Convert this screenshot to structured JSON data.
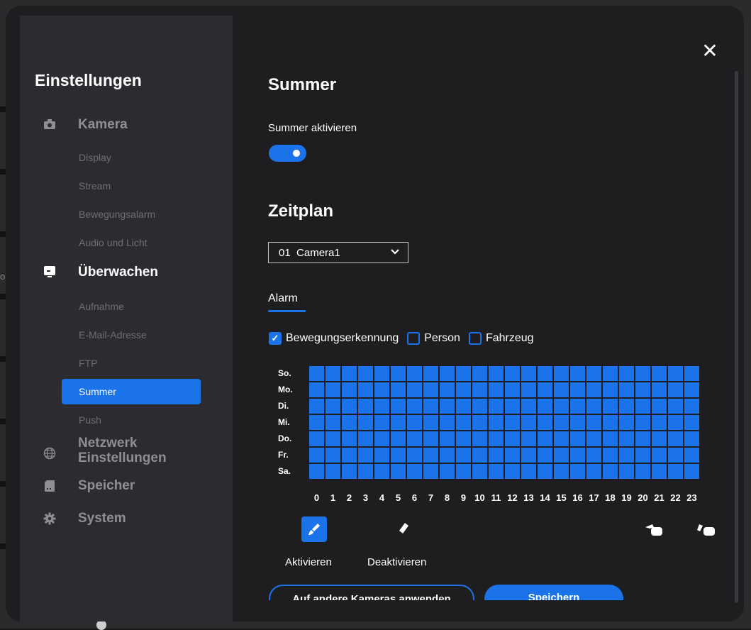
{
  "backdrop": {
    "side_text": "ort"
  },
  "sidebar": {
    "title": "Einstellungen",
    "sections": [
      {
        "label": "Kamera",
        "icon": "camera-icon",
        "items": [
          "Display",
          "Stream",
          "Bewegungsalarm",
          "Audio und Licht"
        ]
      },
      {
        "label": "Überwachen",
        "icon": "monitor-icon",
        "items": [
          "Aufnahme",
          "E-Mail-Adresse",
          "FTP",
          "Summer",
          "Push"
        ],
        "active_item": "Summer"
      },
      {
        "label": "Netzwerk\nEinstellungen",
        "icon": "globe-icon"
      },
      {
        "label": "Speicher",
        "icon": "sd-card-icon"
      },
      {
        "label": "System",
        "icon": "gear-icon"
      }
    ]
  },
  "main": {
    "title": "Summer",
    "toggle_label": "Summer aktivieren",
    "toggle_on": true,
    "schedule_title": "Zeitplan",
    "camera_select": "01  Camera1",
    "tab": "Alarm",
    "checkboxes": [
      {
        "label": "Bewegungserkennung",
        "checked": true
      },
      {
        "label": "Person",
        "checked": false
      },
      {
        "label": "Fahrzeug",
        "checked": false
      }
    ],
    "days": [
      "So.",
      "Mo.",
      "Di.",
      "Mi.",
      "Do.",
      "Fr.",
      "Sa."
    ],
    "hours": [
      "0",
      "1",
      "2",
      "3",
      "4",
      "5",
      "6",
      "7",
      "8",
      "9",
      "10",
      "11",
      "12",
      "13",
      "14",
      "15",
      "16",
      "17",
      "18",
      "19",
      "20",
      "21",
      "22",
      "23"
    ],
    "all_cells_active": true,
    "tools": {
      "activate": "Aktivieren",
      "deactivate": "Deaktivieren"
    },
    "apply_button": "Auf andere Kameras anwenden",
    "save_button": "Speichern"
  },
  "colors": {
    "accent": "#1a73e8",
    "sidebar": "#2c2c30",
    "panel": "#1e1e21"
  }
}
